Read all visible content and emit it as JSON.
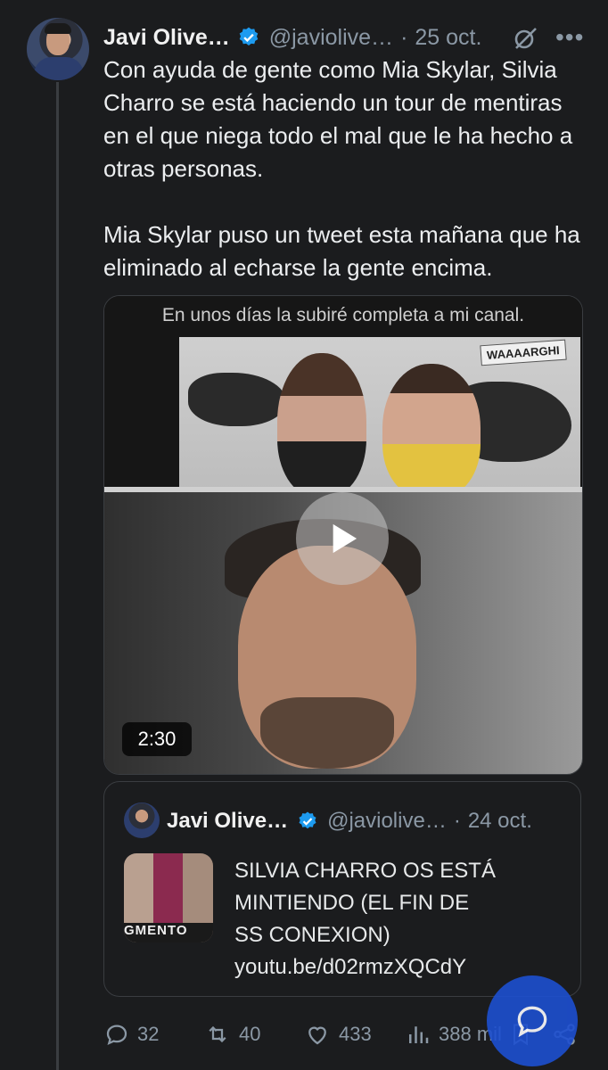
{
  "tweet": {
    "author_name": "Javi Olive…",
    "handle": "@javiolive…",
    "separator": "·",
    "date": "25 oct.",
    "paragraphs": [
      "Con ayuda de gente como Mia Skylar, Silvia Charro se está haciendo un tour de mentiras en el que niega todo el mal que le ha hecho a otras personas.",
      "Mia Skylar puso un tweet esta mañana que ha eliminado al echarse la gente encima."
    ],
    "video": {
      "caption": "En unos días la subiré completa a mi canal.",
      "sticker": "WAAAARGHI",
      "duration": "2:30"
    },
    "quote": {
      "author_name": "Javi Olive…",
      "handle": "@javiolive…",
      "separator": "·",
      "date": "24 oct.",
      "thumb_text": "GMENTO",
      "lines": [
        "SILVIA CHARRO OS ESTÁ",
        "MINTIENDO (EL FIN DE",
        "SS CONEXION)",
        "youtu.be/d02rmzXQCdY"
      ]
    },
    "actions": {
      "replies": "32",
      "retweets": "40",
      "likes": "433",
      "views": "388 mil"
    }
  },
  "colors": {
    "background": "#1b1c1e",
    "verified": "#1d9bf0",
    "fab": "#1d4fd0",
    "muted": "#8b98a5"
  },
  "icons": [
    "verified-badge-icon",
    "grok-icon",
    "more-icon",
    "play-icon",
    "reply-icon",
    "retweet-icon",
    "like-icon",
    "views-icon",
    "bookmark-icon",
    "share-icon",
    "compose-reply-icon"
  ]
}
